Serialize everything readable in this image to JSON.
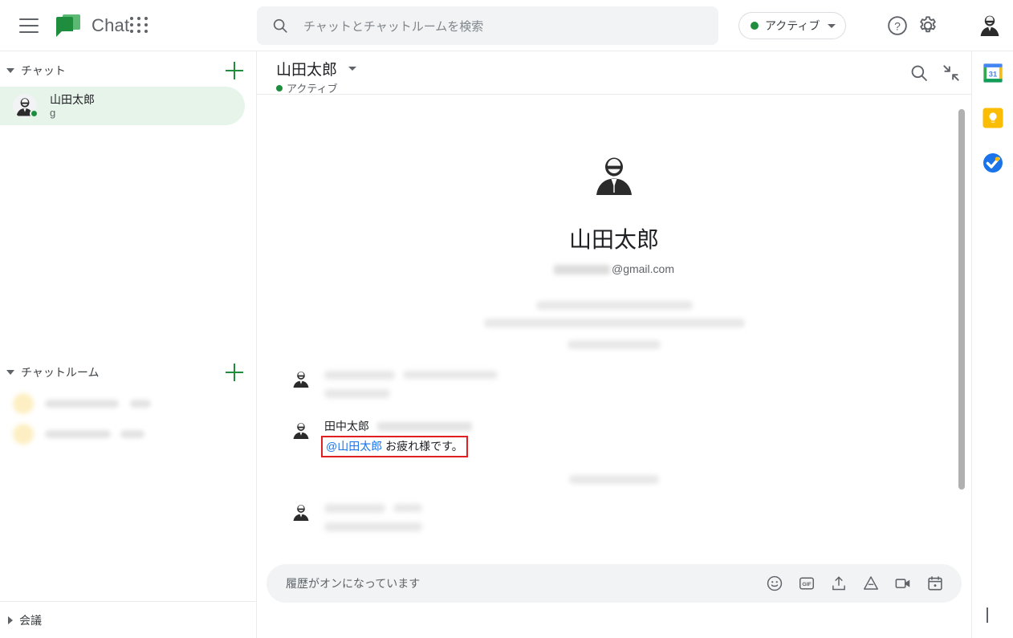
{
  "app": {
    "brand_name": "Chat",
    "menu_icon": "hamburger-icon",
    "logo_icon": "google-chat-logo"
  },
  "search": {
    "placeholder": "チャットとチャットルームを検索",
    "value": "",
    "icon": "search-icon"
  },
  "topbar": {
    "status_label": "アクティブ",
    "status_color": "#1e8e3e",
    "help_icon": "help-icon",
    "settings_icon": "gear-icon",
    "apps_icon": "apps-grid-icon",
    "account_icon": "account-avatar"
  },
  "sidebar": {
    "chat_section": {
      "title": "チャット",
      "add_label": "+",
      "items": [
        {
          "name": "山田太郎",
          "subtitle": "g",
          "selected": true,
          "presence": "active"
        }
      ]
    },
    "rooms_section": {
      "title": "チャットルーム",
      "add_label": "+",
      "items": [
        {
          "name": "",
          "redacted": true
        },
        {
          "name": "",
          "redacted": true
        }
      ]
    },
    "meetings_section": {
      "title": "会議",
      "collapsed": true
    }
  },
  "conversation": {
    "title": "山田太郎",
    "status_text": "アクティブ",
    "status_color": "#1e8e3e",
    "search_icon": "search-icon",
    "collapse_icon": "collapse-arrows-icon",
    "profile": {
      "name": "山田太郎",
      "email_suffix": "@gmail.com",
      "email_prefix_redacted": true,
      "avatar_icon": "person-avatar"
    },
    "messages": [
      {
        "sender": "",
        "timestamp": "",
        "text": "",
        "redacted": true
      },
      {
        "sender": "",
        "timestamp": "",
        "text": "",
        "redacted": true
      },
      {
        "sender": "田中太郎",
        "timestamp": "",
        "timestamp_redacted": true,
        "mention": "@山田太郎",
        "text": " お疲れ様です。",
        "highlighted": true,
        "highlight_color": "#e02020",
        "mention_color": "#1a73e8"
      },
      {
        "sender": "",
        "timestamp": "",
        "text": "",
        "redacted": true
      }
    ]
  },
  "composer": {
    "placeholder": "履歴がオンになっています",
    "value": "",
    "icons": [
      "emoji-icon",
      "gif-icon",
      "upload-icon",
      "google-drive-icon",
      "video-meet-icon",
      "calendar-icon"
    ],
    "send_icon": "send-icon",
    "gif_label": "GIF"
  },
  "right_rail": {
    "icons": [
      {
        "name": "google-calendar-icon",
        "label": "31"
      },
      {
        "name": "google-keep-icon",
        "label": ""
      },
      {
        "name": "google-tasks-icon",
        "label": ""
      }
    ],
    "expand_icon": "chevron-right-icon"
  }
}
